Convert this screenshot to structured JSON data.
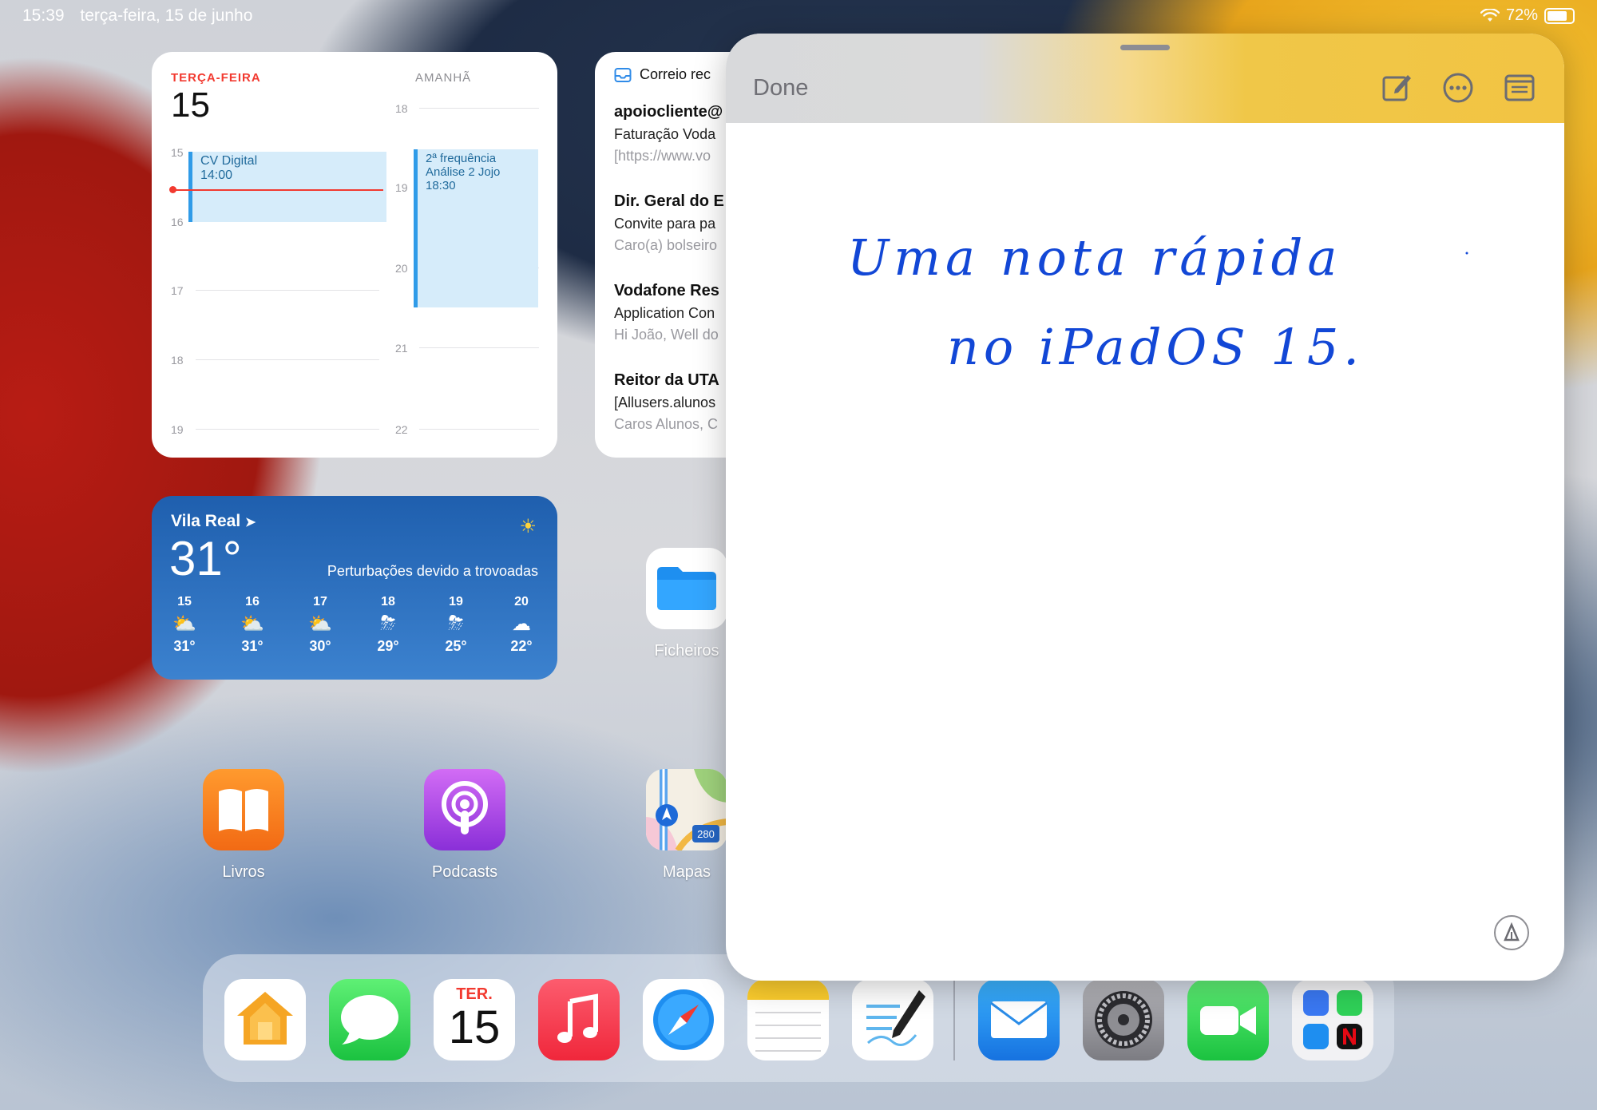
{
  "status_bar": {
    "time": "15:39",
    "date": "terça-feira, 15 de junho",
    "battery": "72%",
    "battery_level": 0.72
  },
  "calendar_widget": {
    "today_label": "TERÇA-FEIRA",
    "today_number": "15",
    "tomorrow_label": "AMANHÃ",
    "today_hours": [
      "15",
      "16",
      "17",
      "18",
      "19"
    ],
    "tomorrow_hours": [
      "18",
      "19",
      "20",
      "21",
      "22"
    ],
    "events_today": [
      {
        "title": "CV Digital",
        "time": "14:00"
      }
    ],
    "events_tomorrow": [
      {
        "title_line1": "2ª frequência",
        "title_line2": "Análise 2 Jojo",
        "time": "18:30"
      }
    ]
  },
  "mail_widget": {
    "header": "Correio rec",
    "items": [
      {
        "from": "apoiocliente@",
        "subject": "Faturação Voda",
        "preview": "[https://www.vo"
      },
      {
        "from": "Dir. Geral do E",
        "subject": "Convite para pa",
        "preview": "Caro(a) bolseiro"
      },
      {
        "from": "Vodafone Res",
        "subject": "Application Con",
        "preview": "Hi João, Well do"
      },
      {
        "from": "Reitor da UTA",
        "subject": "[Allusers.alunos",
        "preview": "Caros Alunos, C"
      }
    ]
  },
  "weather_widget": {
    "city": "Vila Real",
    "temperature": "31°",
    "condition": "Perturbações devido a trovoadas",
    "forecast": [
      {
        "day": "15",
        "icon": "partly-sunny-icon",
        "temp": "31°"
      },
      {
        "day": "16",
        "icon": "partly-sunny-icon",
        "temp": "31°"
      },
      {
        "day": "17",
        "icon": "partly-sunny-icon",
        "temp": "30°"
      },
      {
        "day": "18",
        "icon": "thunderstorm-icon",
        "temp": "29°"
      },
      {
        "day": "19",
        "icon": "thunderstorm-icon",
        "temp": "25°"
      },
      {
        "day": "20",
        "icon": "cloud-icon",
        "temp": "22°"
      }
    ]
  },
  "home_apps": {
    "files": "Ficheiros",
    "books": "Livros",
    "podcasts": "Podcasts",
    "maps": "Mapas",
    "maps_shield": "280"
  },
  "dock": {
    "calendar_day": "TER.",
    "calendar_number": "15"
  },
  "quick_note": {
    "done_label": "Done",
    "handwriting_line1": "Uma nota rápida",
    "handwriting_line2": "no iPadOS 15."
  },
  "colors": {
    "accent_red": "#f23a30",
    "ink_blue": "#1247d6",
    "event_blue": "#2f9be8"
  }
}
